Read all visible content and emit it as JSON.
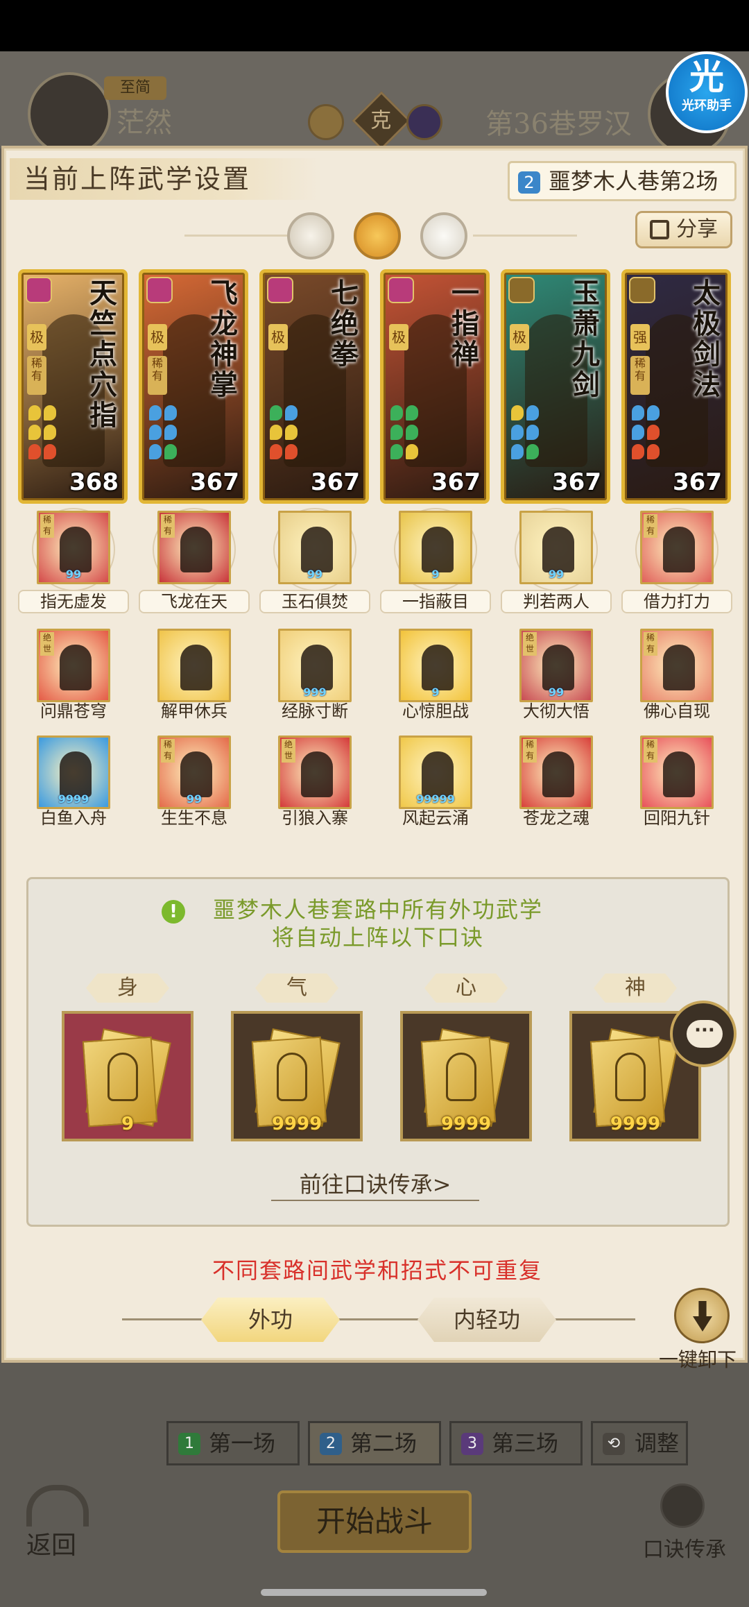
{
  "background": {
    "rank_label": "至简",
    "player_name": "茫然",
    "vs_label": "克",
    "opponent_title": "第36巷罗汉"
  },
  "assistant": {
    "icon_char": "光",
    "label": "光环助手"
  },
  "panel": {
    "title": "当前上阵武学设置",
    "stage_number": "2",
    "stage_label": "噩梦木人巷第2场",
    "share_label": "分享"
  },
  "cards": [
    {
      "name": "天竺点穴指",
      "grade": "极",
      "rarity": "稀有",
      "power": "368",
      "bg": "#e9b46a",
      "badge_color": "#b83b7a",
      "dots": [
        "#e8c43a",
        "#e8c43a",
        "#e8c43a",
        "#e8c43a",
        "#e0502c",
        "#e0502c"
      ]
    },
    {
      "name": "飞龙神掌",
      "grade": "极",
      "rarity": "稀有",
      "power": "367",
      "bg": "#d86a36",
      "badge_color": "#b83b7a",
      "dots": [
        "#4aa0e0",
        "#4aa0e0",
        "#4aa0e0",
        "#4aa0e0",
        "#4aa0e0",
        "#3cb05a"
      ]
    },
    {
      "name": "七绝拳",
      "grade": "极",
      "rarity": "",
      "power": "367",
      "bg": "#7a4a2a",
      "badge_color": "#b83b7a",
      "dots": [
        "#3cb05a",
        "#4aa0e0",
        "#e8c43a",
        "#e8c43a",
        "#e0502c",
        "#e0502c"
      ]
    },
    {
      "name": "一指禅",
      "grade": "极",
      "rarity": "",
      "power": "367",
      "bg": "#c65436",
      "badge_color": "#b83b7a",
      "dots": [
        "#3cb05a",
        "#3cb05a",
        "#3cb05a",
        "#3cb05a",
        "#3cb05a",
        "#e8c43a"
      ]
    },
    {
      "name": "玉萧九剑",
      "grade": "极",
      "rarity": "",
      "power": "367",
      "bg": "#2e8a78",
      "badge_color": "#8a6a2a",
      "dots": [
        "#e8c43a",
        "#4aa0e0",
        "#4aa0e0",
        "#4aa0e0",
        "#4aa0e0",
        "#3cb05a"
      ]
    },
    {
      "name": "太极剑法",
      "grade": "强",
      "rarity": "稀有",
      "power": "367",
      "bg": "#2f2a44",
      "badge_color": "#8a6a2a",
      "dots": [
        "#4aa0e0",
        "#4aa0e0",
        "#4aa0e0",
        "#e0502c",
        "#e0502c",
        "#e0502c"
      ]
    }
  ],
  "skills_row1": [
    {
      "label": "指无虚发",
      "bg": "#d44a4a",
      "level": "99",
      "rare": "稀有"
    },
    {
      "label": "飞龙在天",
      "bg": "#c8343a",
      "level": "",
      "rare": "稀有"
    },
    {
      "label": "玉石俱焚",
      "bg": "#e8cf8a",
      "level": "99",
      "rare": ""
    },
    {
      "label": "一指蔽目",
      "bg": "#e8c44a",
      "level": "9",
      "rare": ""
    },
    {
      "label": "判若两人",
      "bg": "#e8d49a",
      "level": "99",
      "rare": ""
    },
    {
      "label": "借力打力",
      "bg": "#e0605a",
      "level": "",
      "rare": "稀有"
    }
  ],
  "skills_row2": [
    {
      "label": "问鼎苍穹",
      "bg": "#e45a46",
      "level": "",
      "rare": "绝世"
    },
    {
      "label": "解甲休兵",
      "bg": "#f0c44a",
      "level": "",
      "rare": ""
    },
    {
      "label": "经脉寸断",
      "bg": "#f0cf7a",
      "level": "999",
      "rare": ""
    },
    {
      "label": "心惊胆战",
      "bg": "#f2c33a",
      "level": "9",
      "rare": ""
    },
    {
      "label": "大彻大悟",
      "bg": "#c84a52",
      "level": "99",
      "rare": "绝世"
    },
    {
      "label": "佛心自现",
      "bg": "#e8806a",
      "level": "",
      "rare": "稀有"
    }
  ],
  "skills_row3": [
    {
      "label": "白鱼入舟",
      "bg": "#3a9ae0",
      "level": "9999",
      "rare": ""
    },
    {
      "label": "生生不息",
      "bg": "#e46a4a",
      "level": "99",
      "rare": "稀有"
    },
    {
      "label": "引狼入寨",
      "bg": "#d43a3a",
      "level": "",
      "rare": "绝世"
    },
    {
      "label": "风起云涌",
      "bg": "#f0c84a",
      "level": "99999",
      "rare": ""
    },
    {
      "label": "苍龙之魂",
      "bg": "#d8403a",
      "level": "",
      "rare": "稀有"
    },
    {
      "label": "回阳九针",
      "bg": "#e8505a",
      "level": "",
      "rare": "稀有"
    }
  ],
  "formula": {
    "notice_line1": "噩梦木人巷套路中所有外功武学",
    "notice_line2": "将自动上阵以下口诀",
    "excl": "!",
    "slots": [
      {
        "cat": "身",
        "level": "9",
        "bg": "#9a3a48"
      },
      {
        "cat": "气",
        "level": "9999",
        "bg": "#4a3828"
      },
      {
        "cat": "心",
        "level": "9999",
        "bg": "#4a3828"
      },
      {
        "cat": "神",
        "level": "9999",
        "bg": "#4a3828"
      }
    ],
    "link_label": "前往口诀传承>",
    "chat_glyph": "···"
  },
  "warning": "不同套路间武学和招式不可重复",
  "tabs": {
    "outer": "外功",
    "inner": "内轻功",
    "unload": "一键卸下"
  },
  "rounds": [
    {
      "num": "1",
      "label": "第一场",
      "color": "#2f7a3a"
    },
    {
      "num": "2",
      "label": "第二场",
      "color": "#2f5f8a"
    },
    {
      "num": "3",
      "label": "第三场",
      "color": "#5a3a7a"
    }
  ],
  "adjust_label": "调整",
  "start_label": "开始战斗",
  "back_label": "返回",
  "formula_menu_label": "口诀传承"
}
